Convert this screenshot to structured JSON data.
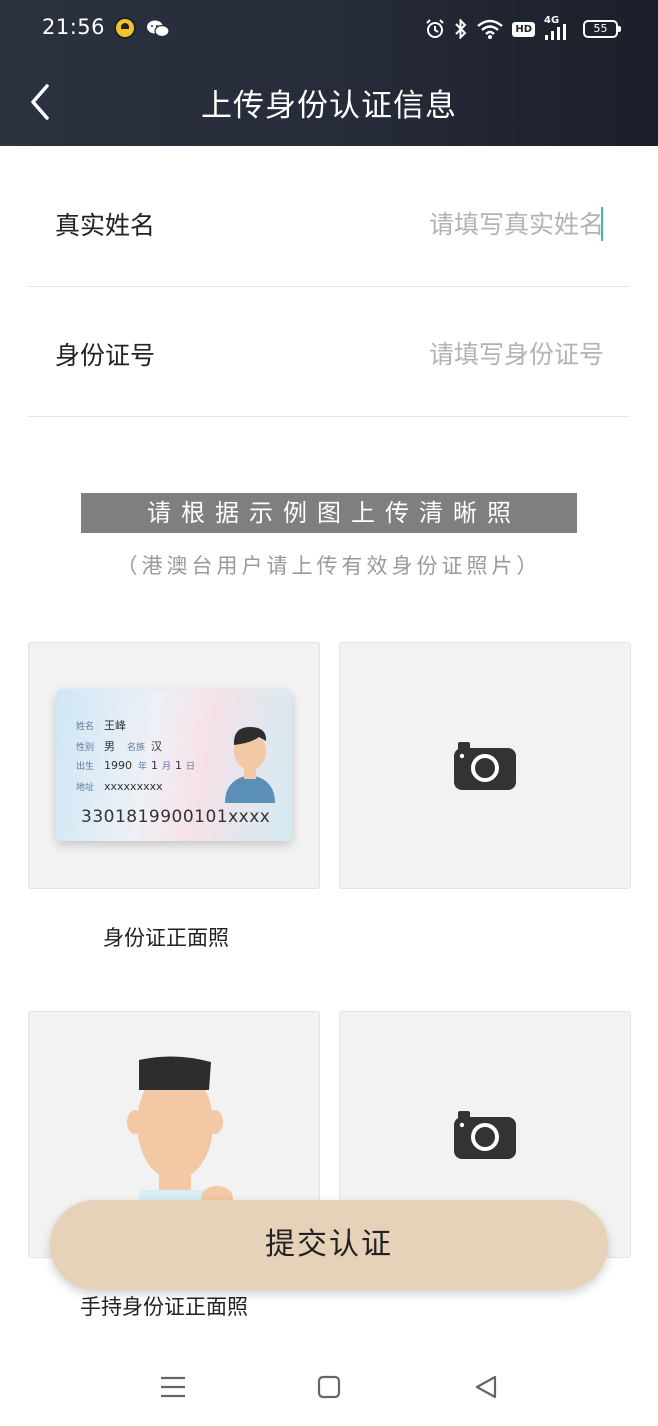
{
  "status_bar": {
    "time": "21:56",
    "icons": [
      "app-badge-icon",
      "wechat-icon",
      "alarm-icon",
      "bluetooth-icon",
      "wifi-icon",
      "hd-icon",
      "signal-4g-icon",
      "battery-icon"
    ],
    "hd_label": "HD",
    "network_label": "4G",
    "battery_level": "55"
  },
  "header": {
    "title": "上传身份认证信息",
    "back_icon": "chevron-left-icon",
    "background_color": "#262c39"
  },
  "form": {
    "name_label": "真实姓名",
    "name_placeholder": "请填写真实姓名",
    "name_value": "",
    "id_label": "身份证号",
    "id_placeholder": "请填写身份证号",
    "id_value": ""
  },
  "instructions": {
    "banner": "请根据示例图上传清晰照",
    "note": "（港澳台用户请上传有效身份证照片）"
  },
  "id_sample": {
    "name_key": "姓名",
    "name_value": "王峰",
    "gender_key": "性别",
    "gender_value": "男",
    "ethnicity_key": "名族",
    "ethnicity_value": "汉",
    "birth_key": "出生",
    "birth_year": "1990",
    "year_unit": "年",
    "birth_month": "1",
    "month_unit": "月",
    "birth_day": "1",
    "day_unit": "日",
    "address_key": "地址",
    "address_value": "xxxxxxxxx",
    "id_number": "3301819900101xxxx"
  },
  "uploads": {
    "front_caption": "身份证正面照",
    "holding_caption": "手持身份证正面照",
    "upload_icon": "camera-icon"
  },
  "submit": {
    "label": "提交认证",
    "color": "#e6d2b9"
  },
  "nav": {
    "icons": [
      "menu-icon",
      "home-square-icon",
      "back-triangle-icon"
    ]
  }
}
